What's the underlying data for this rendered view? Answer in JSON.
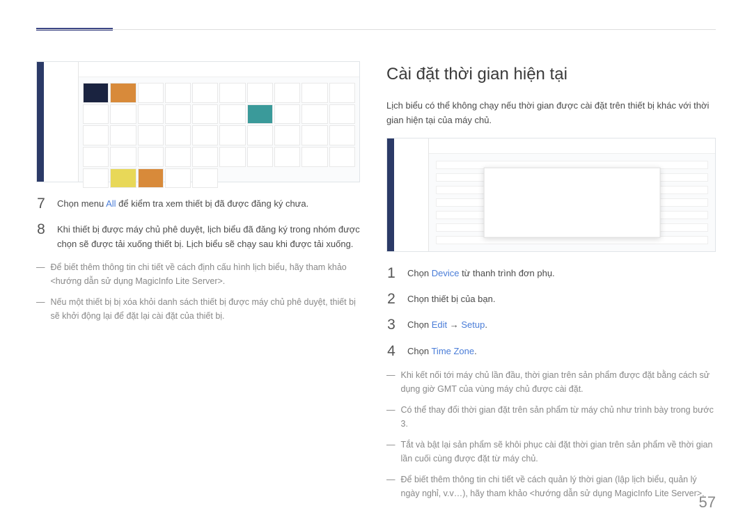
{
  "page_number": "57",
  "left": {
    "steps": [
      {
        "num": "7",
        "prefix": "Chọn menu ",
        "link": "All",
        "suffix": " để kiểm tra xem thiết bị đã được đăng ký chưa."
      },
      {
        "num": "8",
        "text": "Khi thiết bị được máy chủ phê duyệt, lịch biểu đã đăng ký trong nhóm được chọn sẽ được tải xuống thiết bị. Lịch biểu sẽ chạy sau khi được tải xuống."
      }
    ],
    "bullets": [
      "Để biết thêm thông tin chi tiết về cách định cấu hình lịch biểu, hãy tham khảo <hướng dẫn sử dụng MagicInfo Lite Server>.",
      "Nếu một thiết bị bị xóa khỏi danh sách thiết bị được máy chủ phê duyệt, thiết bị sẽ khởi động lại để đặt lại cài đặt của thiết bị."
    ]
  },
  "right": {
    "title": "Cài đặt thời gian hiện tại",
    "intro": "Lịch biểu có thể không chạy nếu thời gian được cài đặt trên thiết bị khác với thời gian hiện tại của máy chủ.",
    "steps": [
      {
        "num": "1",
        "prefix": "Chọn ",
        "link": "Device",
        "suffix": " từ thanh trình đơn phụ."
      },
      {
        "num": "2",
        "text": "Chọn thiết bị của bạn."
      },
      {
        "num": "3",
        "prefix": "Chọn ",
        "link1": "Edit",
        "arrow": " → ",
        "link2": "Setup",
        "suffix": "."
      },
      {
        "num": "4",
        "prefix": "Chọn ",
        "link": "Time Zone",
        "suffix": "."
      }
    ],
    "bullets": [
      "Khi kết nối tới máy chủ lần đầu, thời gian trên sản phẩm được đặt bằng cách sử dụng giờ GMT của vùng máy chủ được cài đặt.",
      "Có thể thay đổi thời gian đặt trên sản phẩm từ máy chủ như trình bày trong bước 3.",
      "Tắt và bật lại sản phẩm sẽ khôi phục cài đặt thời gian trên sản phẩm về thời gian lần cuối cùng được đặt từ máy chủ.",
      "Để biết thêm thông tin chi tiết về cách quản lý thời gian (lập lịch biểu, quản lý ngày nghỉ, v.v…), hãy tham khảo <hướng dẫn sử dụng MagicInfo Lite Server>."
    ]
  }
}
